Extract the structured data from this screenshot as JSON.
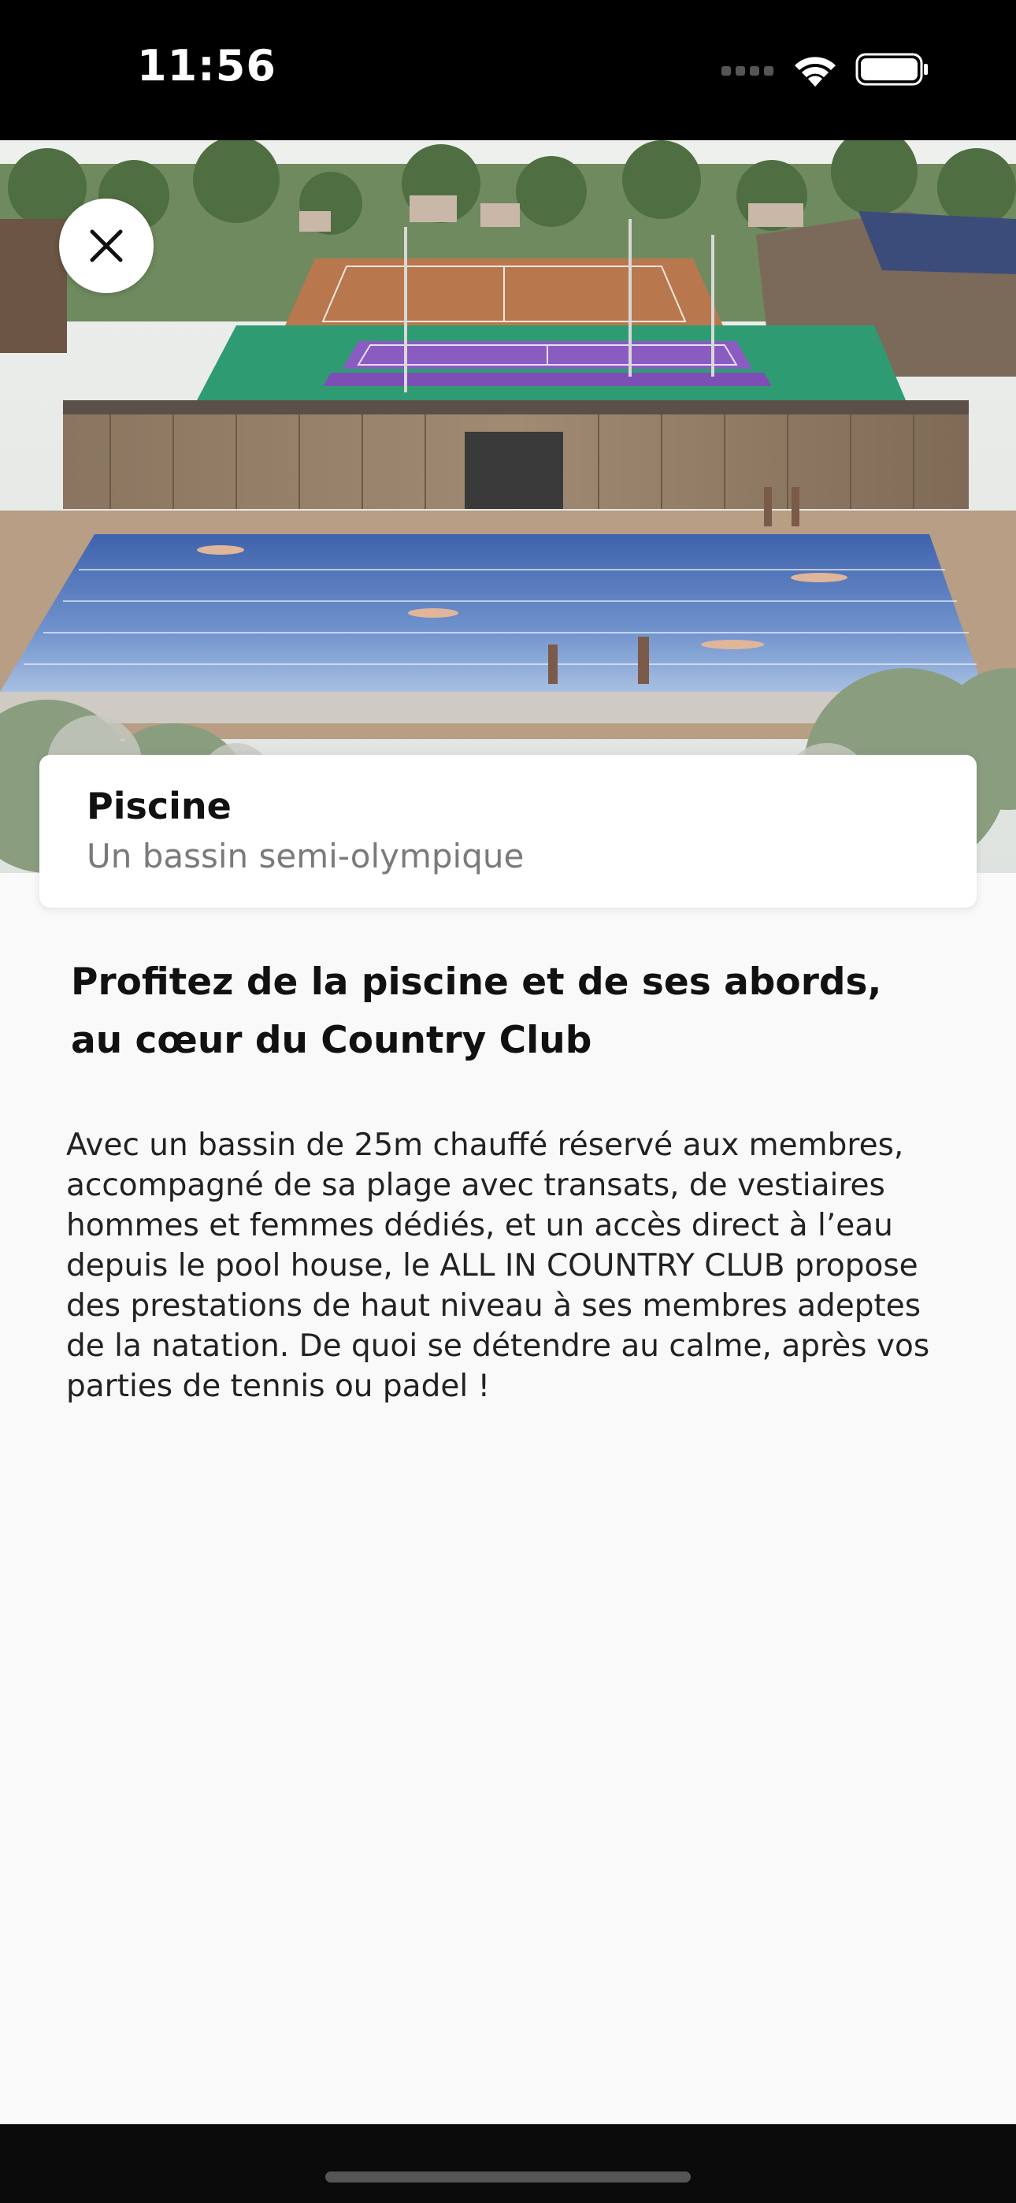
{
  "status_bar": {
    "time": "11:56"
  },
  "hero": {
    "image_description_icon": "pool-hero-image"
  },
  "close_button": {
    "icon": "close-icon"
  },
  "card": {
    "title": "Piscine",
    "subtitle": "Un bassin semi-olympique"
  },
  "content": {
    "headline": "Profitez de la piscine et de ses abords, au cœur du Country Club",
    "body": "Avec un bassin de 25m chauffé réservé aux membres, accompagné de sa plage avec transats, de vestiaires hommes et femmes dédiés, et un accès direct à l’eau depuis le pool house, le ALL IN COUNTRY CLUB propose des prestations de haut niveau à ses membres adeptes de la natation. De quoi se détendre au calme, après vos parties de tennis ou padel !"
  },
  "colors": {
    "background": "#f9f9f9",
    "pool": "#4a6fb4",
    "court": "#8a5cc2",
    "court_surround": "#2f9b72"
  }
}
